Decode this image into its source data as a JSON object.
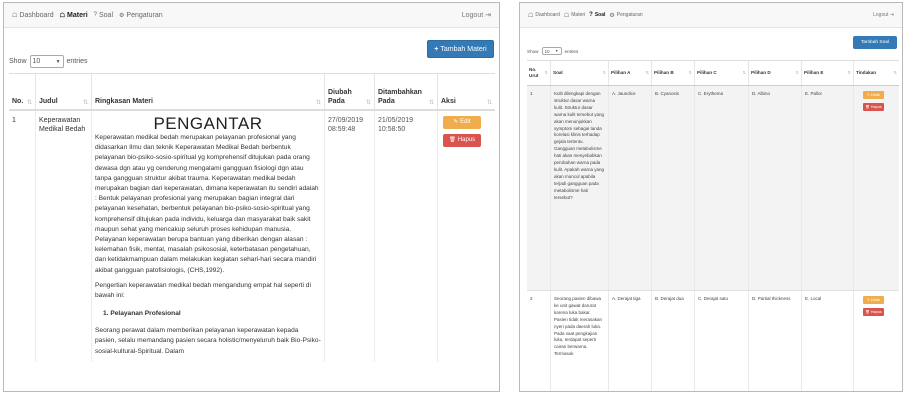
{
  "left": {
    "nav": {
      "dashboard": "Dashboard",
      "materi": "Materi",
      "soal": "Soal",
      "pengaturan": "Pengaturan",
      "logout": "Logout"
    },
    "add_button": "Tambah Materi",
    "show_label": "Show",
    "entries_value": "10",
    "entries_label": "entries",
    "table": {
      "headers": [
        "No.",
        "Judul",
        "Ringkasan Materi",
        "Diubah Pada",
        "Ditambahkan Pada",
        "Aksi"
      ],
      "rows": [
        {
          "no": "1",
          "judul": "Keperawatan Medikal Bedah",
          "title": "PENGANTAR",
          "para1": "Keperawatan medikal bedah merupakan pelayanan profesional yang didasarkan Ilmu dan teknik Keperawatan Medikal Bedah berbentuk pelayanan bio-psiko-sosio-spiritual yg komprehensif ditujukan pada orang dewasa dgn atau yg cenderung mengalami gangguan fisiologi dgn atau tanpa gangguan struktur akibat trauma. Keperawatan medikal bedah merupakan bagian dari keperawatan, dimana keperawatan itu sendiri adalah : Bentuk pelayanan profesional yang merupakan bagian integral dari pelayanan kesehatan, berbentuk pelayanan bio-psiko-sosio-spiritual yang komprehensif ditujukan pada individu, keluarga dan masyarakat baik sakit maupun sehat yang mencakup seluruh proses kehidupan manusia. Pelayanan keperawatan berupa bantuan yang diberikan dengan alasan : kelemahan fisik, mental, masalah psikososial, keterbatasan pengetahuan, dan ketidakmampuan dalam melakukan kegiatan sehari-hari secara mandiri akibat gangguan patofisiologis, (CHS,1992).",
          "para2": "Pengertian keperawatan medikal bedah mengandung empat hal seperti di bawah ini:",
          "subhead": "1. Pelayanan Profesional",
          "para3": "Seorang perawat dalam memberikan pelayanan keperawatan kepada pasien, selalu memandang pasien secara holistic/menyeluruh baik Bio-Psiko-sosial-kultural-Spiritual. Dalam",
          "diubah": "27/09/2019 08:59:48",
          "ditambahkan": "21/05/2019 10:58:50",
          "edit": "Edit",
          "hapus": "Hapus"
        }
      ]
    }
  },
  "right": {
    "nav": {
      "dashboard": "Dashboard",
      "materi": "Materi",
      "soal": "Soal",
      "pengaturan": "Pengaturan",
      "logout": "Logout"
    },
    "add_button": "Tambah Soal",
    "show_label": "Show",
    "entries_value": "10",
    "entries_label": "entries",
    "table": {
      "headers": [
        "No. Urut",
        "Soal",
        "Pilihan A",
        "Pilihan B",
        "Pilihan C",
        "Pilihan D",
        "Pilihan E",
        "Tindakan"
      ],
      "rows": [
        {
          "no": "1",
          "soal": "Kulit dilengkapi dengan struktur dasar warna kulit. Struktur dasar warna kulit tersebut yang akan menunjukkan symptom sebagai tanda korelasi klinis terhadap gejala tertentu. Gangguan metabolisme hati akan menyebabkan perubahan warna pada kulit. Apakah warna yang akan muncul apabila terjadi gangguan pada metabolisme hati tersebut?",
          "a": "A. Jaundice",
          "b": "B. Cyanosis",
          "c": "C. Erythema",
          "d": "D. Albino",
          "e": "E. Pallor",
          "ubah": "Ubah",
          "hapus": "Hapus"
        },
        {
          "no": "2",
          "soal": "Seorang pasien dibawa ke unit gawat darurat karena luka bakar. Pasien tidak merasakan nyeri pada daerah luka. Pada saat pengkajian luka, terdapat seperti cairan berwarna. Termasuk",
          "a": "A. Derajat tiga",
          "b": "B. Derajat dua",
          "c": "C. Derajat satu",
          "d": "D. Partial thickness",
          "e": "E. Local",
          "ubah": "Ubah",
          "hapus": "Hapus"
        }
      ]
    }
  }
}
